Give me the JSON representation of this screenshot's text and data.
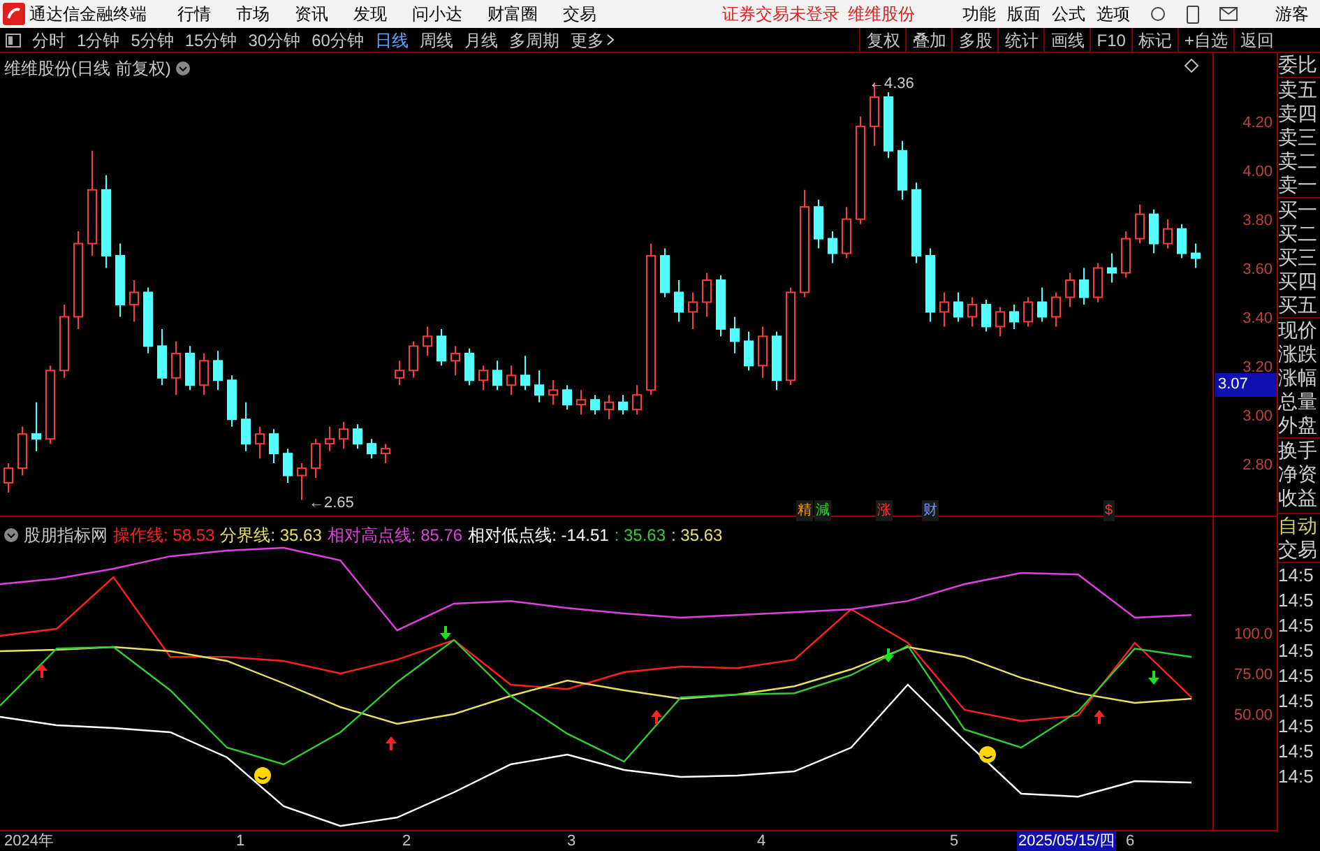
{
  "top_bar": {
    "app_title": "通达信金融终端",
    "menu": [
      "行情",
      "市场",
      "资讯",
      "发现",
      "问小达",
      "财富圈",
      "交易"
    ],
    "notice": "证券交易未登录",
    "stock_link": "维维股份",
    "right_menu": [
      "功能",
      "版面",
      "公式",
      "选项"
    ],
    "user": "游客"
  },
  "toolbar": {
    "periods": [
      {
        "label": "分时",
        "selected": false
      },
      {
        "label": "1分钟",
        "selected": false
      },
      {
        "label": "5分钟",
        "selected": false
      },
      {
        "label": "15分钟",
        "selected": false
      },
      {
        "label": "30分钟",
        "selected": false
      },
      {
        "label": "60分钟",
        "selected": false
      },
      {
        "label": "日线",
        "selected": true
      },
      {
        "label": "周线",
        "selected": false
      },
      {
        "label": "月线",
        "selected": false
      },
      {
        "label": "多周期",
        "selected": false
      },
      {
        "label": "更多",
        "selected": false
      }
    ],
    "buttons": [
      "复权",
      "叠加",
      "多股",
      "统计",
      "画线",
      "F10",
      "标记",
      "+自选",
      "返回"
    ]
  },
  "price_chart": {
    "title": "维维股份(日线 前复权)",
    "high_label": "←4.36",
    "low_label": "←2.65",
    "current_price": "3.07",
    "signals": [
      {
        "text": "精",
        "color": "#ff9900"
      },
      {
        "text": "減",
        "color": "#33cc33"
      },
      {
        "text": "涨",
        "color": "#ff3333"
      },
      {
        "text": "财",
        "color": "#6699ff"
      },
      {
        "text": "$",
        "color": "#ff3333"
      }
    ],
    "chart_data": {
      "type": "candlestick",
      "ylim": [
        2.58,
        4.48
      ],
      "yticks": [
        {
          "value": 4.2,
          "label": "4.20"
        },
        {
          "value": 4.0,
          "label": "4.00"
        },
        {
          "value": 3.8,
          "label": "3.80"
        },
        {
          "value": 3.6,
          "label": "3.60"
        },
        {
          "value": 3.4,
          "label": "3.40"
        },
        {
          "value": 3.2,
          "label": "3.20"
        },
        {
          "value": 3.0,
          "label": "3.00"
        },
        {
          "value": 2.8,
          "label": "2.80"
        }
      ],
      "ohlc": [
        [
          2.72,
          2.8,
          2.68,
          2.78
        ],
        [
          2.78,
          2.95,
          2.75,
          2.92
        ],
        [
          2.92,
          3.05,
          2.85,
          2.9
        ],
        [
          2.9,
          3.2,
          2.88,
          3.18
        ],
        [
          3.18,
          3.45,
          3.15,
          3.4
        ],
        [
          3.4,
          3.75,
          3.35,
          3.7
        ],
        [
          3.7,
          4.08,
          3.65,
          3.92
        ],
        [
          3.92,
          3.98,
          3.6,
          3.65
        ],
        [
          3.65,
          3.7,
          3.4,
          3.45
        ],
        [
          3.45,
          3.55,
          3.38,
          3.5
        ],
        [
          3.5,
          3.52,
          3.25,
          3.28
        ],
        [
          3.28,
          3.35,
          3.12,
          3.15
        ],
        [
          3.15,
          3.3,
          3.08,
          3.25
        ],
        [
          3.25,
          3.28,
          3.1,
          3.12
        ],
        [
          3.12,
          3.25,
          3.08,
          3.22
        ],
        [
          3.22,
          3.26,
          3.1,
          3.14
        ],
        [
          3.14,
          3.16,
          2.95,
          2.98
        ],
        [
          2.98,
          3.05,
          2.85,
          2.88
        ],
        [
          2.88,
          2.95,
          2.82,
          2.92
        ],
        [
          2.92,
          2.94,
          2.8,
          2.84
        ],
        [
          2.84,
          2.86,
          2.72,
          2.75
        ],
        [
          2.75,
          2.8,
          2.65,
          2.78
        ],
        [
          2.78,
          2.9,
          2.74,
          2.88
        ],
        [
          2.88,
          2.95,
          2.85,
          2.9
        ],
        [
          2.9,
          2.97,
          2.86,
          2.94
        ],
        [
          2.94,
          2.96,
          2.86,
          2.88
        ],
        [
          2.88,
          2.9,
          2.82,
          2.84
        ],
        [
          2.84,
          2.88,
          2.8,
          2.86
        ],
        [
          3.15,
          3.22,
          3.12,
          3.18
        ],
        [
          3.18,
          3.3,
          3.15,
          3.28
        ],
        [
          3.28,
          3.36,
          3.24,
          3.32
        ],
        [
          3.32,
          3.35,
          3.2,
          3.22
        ],
        [
          3.22,
          3.28,
          3.16,
          3.25
        ],
        [
          3.25,
          3.27,
          3.12,
          3.14
        ],
        [
          3.14,
          3.2,
          3.1,
          3.18
        ],
        [
          3.18,
          3.22,
          3.1,
          3.12
        ],
        [
          3.12,
          3.2,
          3.08,
          3.16
        ],
        [
          3.16,
          3.24,
          3.1,
          3.12
        ],
        [
          3.12,
          3.18,
          3.05,
          3.08
        ],
        [
          3.08,
          3.14,
          3.04,
          3.1
        ],
        [
          3.1,
          3.12,
          3.02,
          3.04
        ],
        [
          3.04,
          3.1,
          3.0,
          3.06
        ],
        [
          3.06,
          3.08,
          3.0,
          3.02
        ],
        [
          3.02,
          3.08,
          2.98,
          3.05
        ],
        [
          3.05,
          3.08,
          3.0,
          3.02
        ],
        [
          3.02,
          3.12,
          3.0,
          3.08
        ],
        [
          3.1,
          3.7,
          3.08,
          3.65
        ],
        [
          3.65,
          3.68,
          3.48,
          3.5
        ],
        [
          3.5,
          3.55,
          3.38,
          3.42
        ],
        [
          3.42,
          3.5,
          3.35,
          3.46
        ],
        [
          3.46,
          3.58,
          3.4,
          3.55
        ],
        [
          3.55,
          3.57,
          3.32,
          3.35
        ],
        [
          3.35,
          3.4,
          3.25,
          3.3
        ],
        [
          3.3,
          3.34,
          3.18,
          3.2
        ],
        [
          3.2,
          3.36,
          3.15,
          3.32
        ],
        [
          3.32,
          3.34,
          3.1,
          3.14
        ],
        [
          3.14,
          3.52,
          3.12,
          3.5
        ],
        [
          3.5,
          3.92,
          3.48,
          3.85
        ],
        [
          3.85,
          3.88,
          3.68,
          3.72
        ],
        [
          3.72,
          3.75,
          3.62,
          3.66
        ],
        [
          3.66,
          3.85,
          3.64,
          3.8
        ],
        [
          3.8,
          4.22,
          3.78,
          4.18
        ],
        [
          4.18,
          4.36,
          4.1,
          4.3
        ],
        [
          4.3,
          4.32,
          4.05,
          4.08
        ],
        [
          4.08,
          4.12,
          3.88,
          3.92
        ],
        [
          3.92,
          3.95,
          3.62,
          3.65
        ],
        [
          3.65,
          3.68,
          3.38,
          3.42
        ],
        [
          3.42,
          3.5,
          3.36,
          3.46
        ],
        [
          3.46,
          3.5,
          3.38,
          3.4
        ],
        [
          3.4,
          3.48,
          3.36,
          3.45
        ],
        [
          3.45,
          3.47,
          3.34,
          3.36
        ],
        [
          3.36,
          3.44,
          3.32,
          3.42
        ],
        [
          3.42,
          3.45,
          3.35,
          3.38
        ],
        [
          3.38,
          3.48,
          3.36,
          3.46
        ],
        [
          3.46,
          3.52,
          3.38,
          3.4
        ],
        [
          3.4,
          3.5,
          3.36,
          3.48
        ],
        [
          3.48,
          3.58,
          3.44,
          3.55
        ],
        [
          3.55,
          3.6,
          3.45,
          3.48
        ],
        [
          3.48,
          3.62,
          3.46,
          3.6
        ],
        [
          3.6,
          3.66,
          3.54,
          3.58
        ],
        [
          3.58,
          3.75,
          3.56,
          3.72
        ],
        [
          3.72,
          3.86,
          3.7,
          3.82
        ],
        [
          3.82,
          3.84,
          3.66,
          3.7
        ],
        [
          3.7,
          3.8,
          3.68,
          3.76
        ],
        [
          3.76,
          3.78,
          3.64,
          3.66
        ],
        [
          3.66,
          3.7,
          3.6,
          3.64
        ]
      ]
    }
  },
  "indicator": {
    "name": "股朋指标网",
    "readings": [
      ": 58.53",
      ": 35.63",
      ": 85.76",
      ": -14.51",
      ": 35.63",
      ": 35.63"
    ],
    "chart_data": {
      "type": "line",
      "ylim": [
        -22.4,
        171.6
      ],
      "yticks": [
        {
          "value": 100,
          "label": "100.0"
        },
        {
          "value": 75,
          "label": "75.00"
        },
        {
          "value": 50,
          "label": "50.00"
        }
      ],
      "series": [
        {
          "name": "操作线",
          "color": "#ff2020",
          "values": [
            98.3,
            102.6,
            134.5,
            85.3,
            85.3,
            82.8,
            75.0,
            83.6,
            95.7,
            68.1,
            65.5,
            75.9,
            79.3,
            78.4,
            83.6,
            114.7,
            94.0,
            52.6,
            45.7,
            49.1,
            94.0,
            60.3
          ]
        },
        {
          "name": "分界线",
          "color": "#e8e060",
          "values": [
            88.8,
            89.7,
            91.4,
            88.8,
            82.8,
            69.0,
            54.3,
            44.0,
            50.0,
            61.2,
            70.7,
            64.7,
            59.5,
            62.1,
            67.2,
            77.6,
            91.4,
            85.3,
            72.4,
            62.9,
            56.9,
            59.5
          ]
        },
        {
          "name": "相对高点线",
          "color": "#e040e0",
          "values": [
            130.2,
            133.6,
            139.7,
            147.4,
            150.9,
            152.6,
            144.8,
            101.7,
            118.1,
            119.8,
            115.5,
            112.1,
            109.5,
            111.2,
            112.9,
            114.7,
            119.8,
            130.2,
            137.1,
            136.2,
            109.5,
            111.2
          ]
        },
        {
          "name": "相对低点线",
          "color": "#ffffff",
          "values": [
            48.3,
            43.1,
            41.4,
            38.8,
            23.3,
            -6.9,
            -19.0,
            -13.8,
            1.7,
            19.0,
            25.0,
            15.5,
            11.2,
            12.1,
            14.7,
            29.3,
            68.1,
            33.6,
            0.9,
            -0.9,
            8.6,
            7.8
          ]
        },
        {
          "color": "#33cc33",
          "values": [
            55.2,
            90.5,
            91.4,
            64.7,
            29.3,
            19.0,
            38.8,
            69.8,
            95.7,
            61.2,
            37.9,
            20.7,
            60.3,
            62.1,
            62.9,
            74.1,
            92.2,
            40.5,
            29.3,
            51.7,
            90.5,
            85.3
          ]
        }
      ]
    }
  },
  "x_axis": {
    "labels": [
      {
        "text": "2024年",
        "selected": false
      },
      {
        "text": "1",
        "selected": false
      },
      {
        "text": "2",
        "selected": false
      },
      {
        "text": "3",
        "selected": false
      },
      {
        "text": "4",
        "selected": false
      },
      {
        "text": "5",
        "selected": false
      },
      {
        "text": "2025/05/15/四",
        "selected": true
      },
      {
        "text": "6",
        "selected": false
      }
    ]
  },
  "side_panel": {
    "labels": [
      "委比",
      "卖五",
      "卖四",
      "卖三",
      "卖二",
      "卖一",
      "买一",
      "买二",
      "买三",
      "买四",
      "买五",
      "现价",
      "涨跌",
      "涨幅",
      "总量",
      "外盘",
      "换手",
      "净资",
      "收益"
    ],
    "auto": "自动",
    "trade": "交易",
    "times": [
      "14:5",
      "14:5",
      "14:5",
      "14:5",
      "14:5",
      "14:5",
      "14:5",
      "14:5",
      "14:5"
    ]
  }
}
